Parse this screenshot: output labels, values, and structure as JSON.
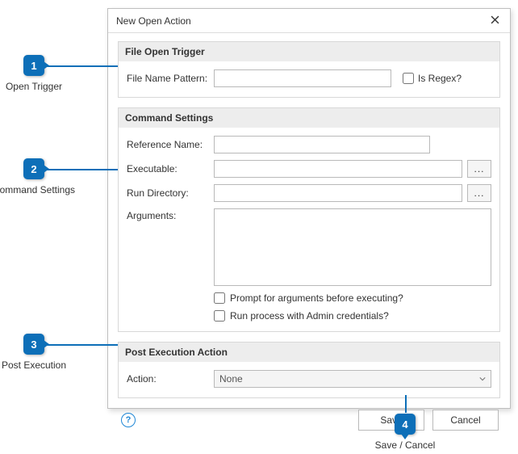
{
  "dialog": {
    "title": "New Open Action"
  },
  "trigger": {
    "header": "File Open Trigger",
    "pattern_label": "File Name Pattern:",
    "pattern_value": "",
    "is_regex_label": "Is Regex?"
  },
  "command": {
    "header": "Command Settings",
    "ref_label": "Reference Name:",
    "ref_value": "",
    "exe_label": "Executable:",
    "exe_value": "",
    "run_label": "Run Directory:",
    "run_value": "",
    "args_label": "Arguments:",
    "args_value": "",
    "browse_label": "...",
    "prompt_label": "Prompt for arguments before executing?",
    "admin_label": "Run process with Admin credentials?"
  },
  "post": {
    "header": "Post Execution Action",
    "action_label": "Action:",
    "action_value": "None"
  },
  "footer": {
    "help_glyph": "?",
    "save_label": "Save",
    "cancel_label": "Cancel"
  },
  "callouts": {
    "c1_num": "1",
    "c1_label": "Open Trigger",
    "c2_num": "2",
    "c2_label": "Command Settings",
    "c3_num": "3",
    "c3_label": "Post Execution",
    "c4_num": "4",
    "c4_label": "Save / Cancel"
  }
}
